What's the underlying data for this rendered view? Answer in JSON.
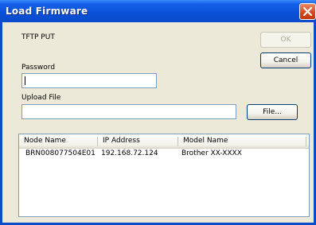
{
  "window": {
    "title": "Load Firmware"
  },
  "protocol_label": "TFTP PUT",
  "buttons": {
    "ok": "OK",
    "cancel": "Cancel",
    "file": "File..."
  },
  "password": {
    "label": "Password",
    "value": ""
  },
  "upload": {
    "label": "Upload File",
    "value": ""
  },
  "table": {
    "columns": [
      "Node Name",
      "IP Address",
      "Model Name"
    ],
    "rows": [
      [
        "BRN008077504E01",
        "192.168.72.124",
        "Brother XX-XXXX"
      ]
    ]
  }
}
